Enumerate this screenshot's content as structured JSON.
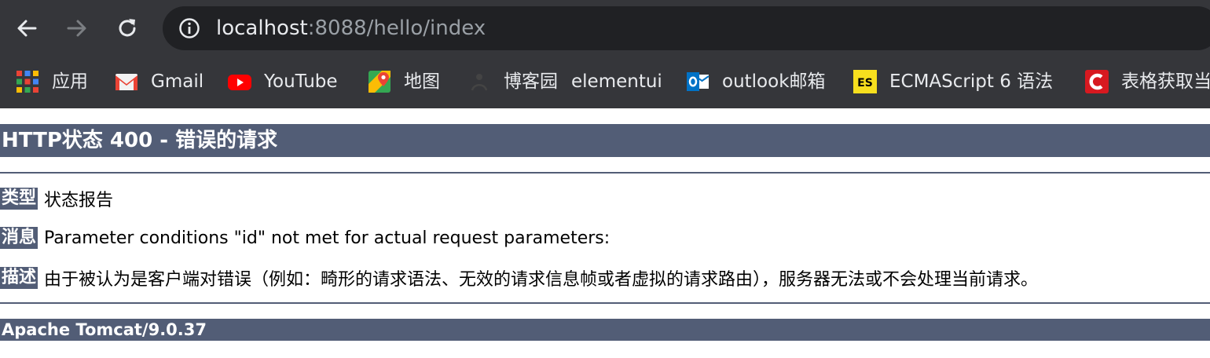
{
  "browser": {
    "url_host": "localhost",
    "url_path": ":8088/hello/index",
    "icons": {
      "back": "arrow-left-icon",
      "forward": "arrow-right-icon",
      "reload": "reload-icon",
      "site_info": "info-circle-icon"
    }
  },
  "bookmarks": [
    {
      "label": "应用",
      "icon": "apps-grid-icon"
    },
    {
      "label": "Gmail",
      "icon": "gmail-icon"
    },
    {
      "label": "YouTube",
      "icon": "youtube-icon"
    },
    {
      "label": "地图",
      "icon": "maps-icon"
    },
    {
      "label": "博客园",
      "icon": "blog-icon"
    },
    {
      "label": "elementui",
      "icon": ""
    },
    {
      "label": "outlook邮箱",
      "icon": "outlook-icon"
    },
    {
      "label": "ECMAScript 6 语法",
      "icon": "es-icon"
    },
    {
      "label": "表格获取当",
      "icon": "c-logo-icon"
    }
  ],
  "page": {
    "title": "HTTP状态 400 - 错误的请求",
    "type_label": "类型",
    "type_value": "状态报告",
    "message_label": "消息",
    "message_value": "Parameter conditions \"id\" not met for actual request parameters:",
    "description_label": "描述",
    "description_value": "由于被认为是客户端对错误（例如：畸形的请求语法、无效的请求信息帧或者虚拟的请求路由），服务器无法或不会处理当前请求。",
    "footer": "Apache Tomcat/9.0.37"
  },
  "colors": {
    "header_bar": "#525d76",
    "chrome_bg": "#35363a",
    "omnibox_bg": "#202124"
  }
}
